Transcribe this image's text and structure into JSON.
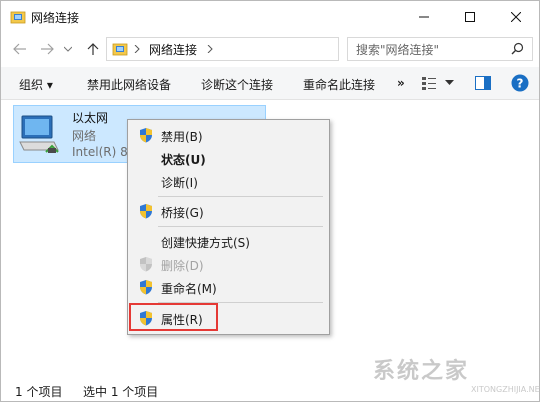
{
  "window": {
    "title": "网络连接"
  },
  "address": {
    "location": "网络连接",
    "search_placeholder": "搜索\"网络连接\""
  },
  "commands": {
    "organize": "组织 ▾",
    "disable": "禁用此网络设备",
    "diagnose": "诊断这个连接",
    "rename": "重命名此连接",
    "more": "»"
  },
  "item": {
    "name": "以太网",
    "type": "网络",
    "device": "Intel(R) 82"
  },
  "menu": {
    "items": [
      {
        "label": "禁用(B)"
      },
      {
        "label": "状态(U)"
      },
      {
        "label": "诊断(I)"
      },
      {
        "label": "桥接(G)"
      },
      {
        "label": "创建快捷方式(S)"
      },
      {
        "label": "删除(D)"
      },
      {
        "label": "重命名(M)"
      },
      {
        "label": "属性(R)"
      }
    ]
  },
  "status": {
    "count": "1 个项目",
    "selected": "选中 1 个项目"
  },
  "watermark": {
    "text": "系统之家",
    "url": "XITONGZHIJIA.NET"
  },
  "colors": {
    "selection": "#cce8ff",
    "highlight": "#e53935",
    "help": "#1a6fc4"
  }
}
